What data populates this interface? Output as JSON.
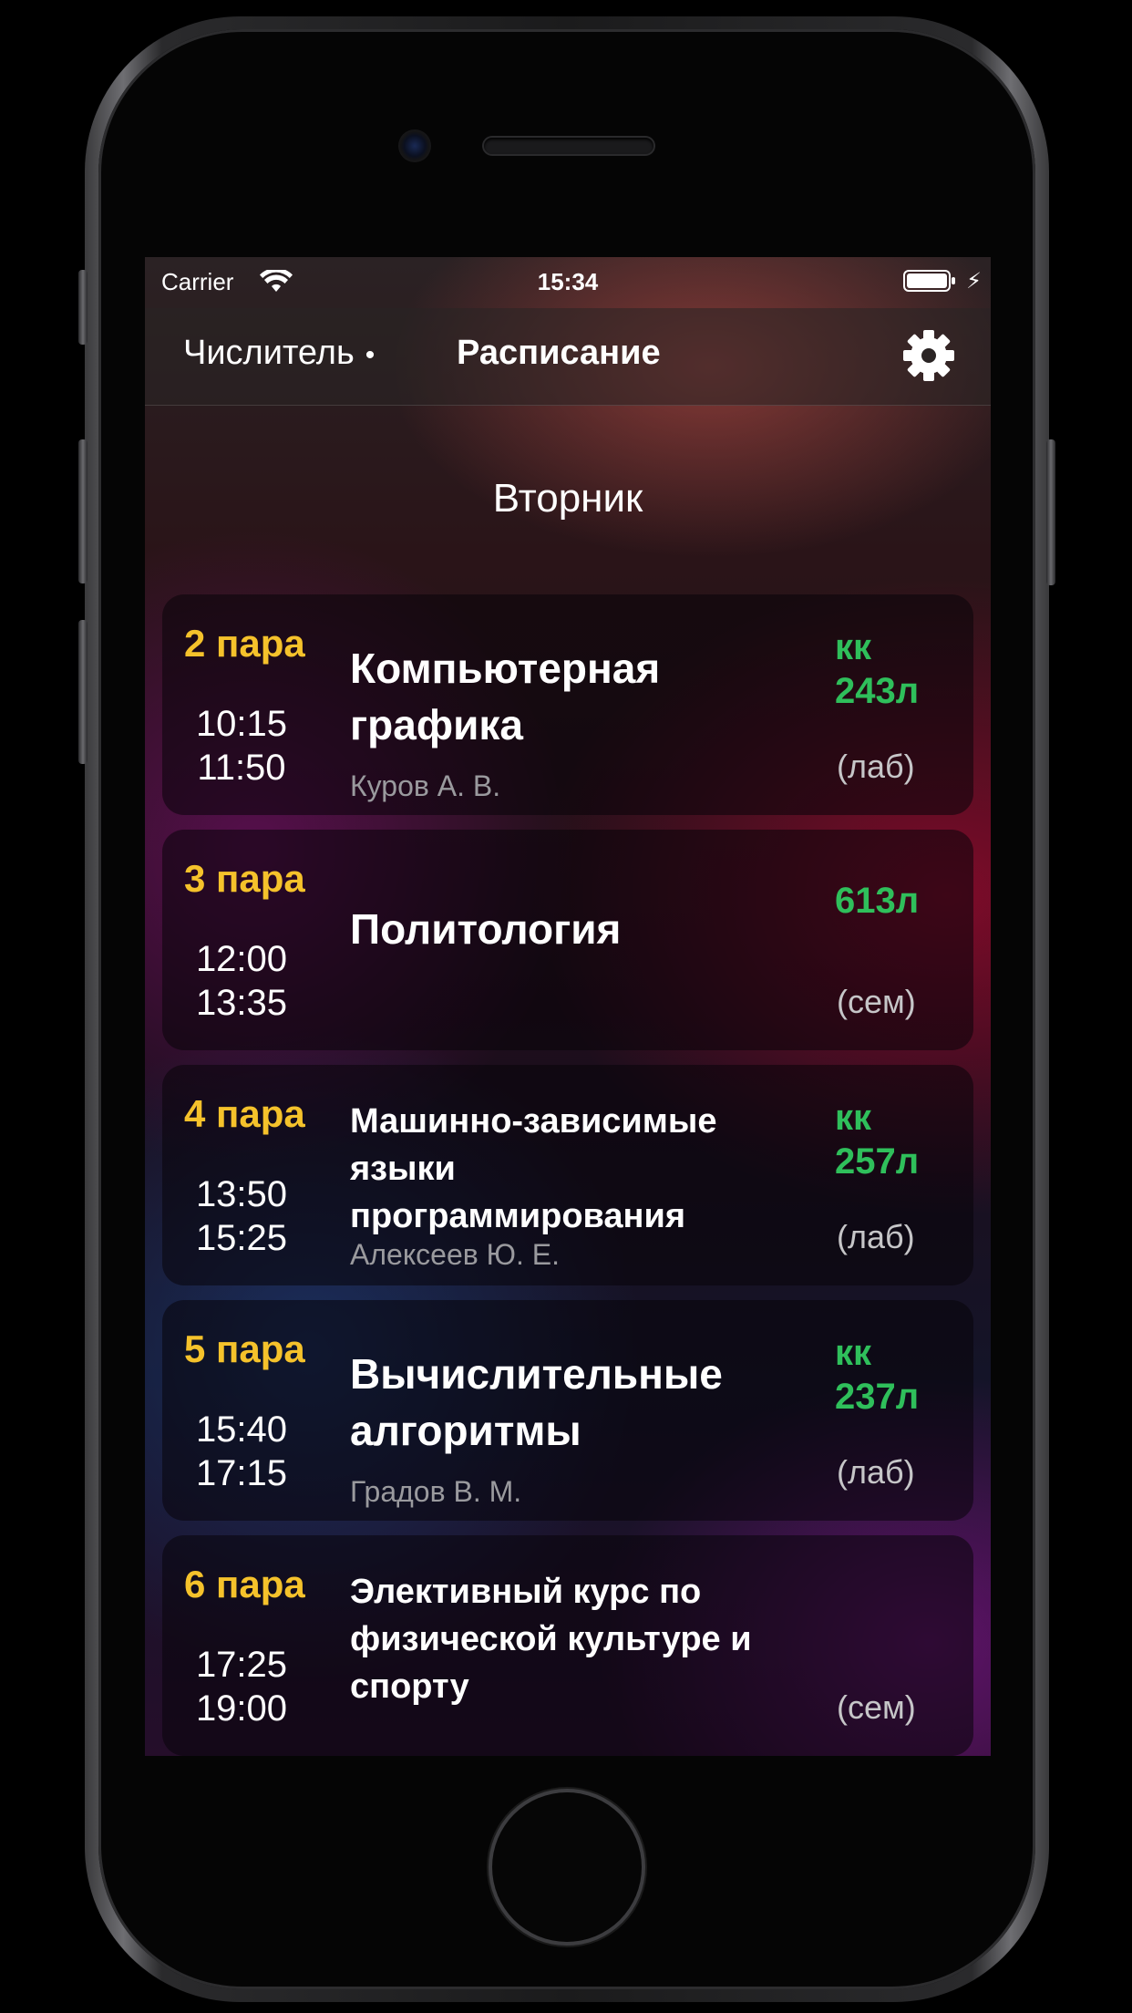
{
  "status_bar": {
    "carrier": "Carrier",
    "time": "15:34"
  },
  "nav": {
    "left_label": "Числитель",
    "left_dot": "•",
    "title": "Расписание",
    "settings_icon": "gear-icon"
  },
  "day": "Вторник",
  "colors": {
    "pair": "#f5c22b",
    "room": "#2fbf5b",
    "teacher": "#9a9a9e"
  },
  "lessons": [
    {
      "pair": "2 пара",
      "start": "10:15",
      "end": "11:50",
      "subject_lines": [
        "Компьютерная",
        "графика"
      ],
      "teacher": "Куров А. В.",
      "room_prefix": "кк",
      "room": "243л",
      "type": "(лаб)"
    },
    {
      "pair": "3 пара",
      "start": "12:00",
      "end": "13:35",
      "subject_lines": [
        "Политология"
      ],
      "teacher": "",
      "room_prefix": "",
      "room": "613л",
      "type": "(сем)"
    },
    {
      "pair": "4 пара",
      "start": "13:50",
      "end": "15:25",
      "subject_lines": [
        "Машинно-зависимые",
        "языки",
        "программирования"
      ],
      "teacher": "Алексеев Ю. Е.",
      "room_prefix": "кк",
      "room": "257л",
      "type": "(лаб)"
    },
    {
      "pair": "5 пара",
      "start": "15:40",
      "end": "17:15",
      "subject_lines": [
        "Вычислительные",
        "алгоритмы"
      ],
      "teacher": "Градов В. М.",
      "room_prefix": "кк",
      "room": "237л",
      "type": "(лаб)"
    },
    {
      "pair": "6 пара",
      "start": "17:25",
      "end": "19:00",
      "subject_lines": [
        "Элективный курс по",
        "физической культуре и",
        "спорту"
      ],
      "teacher": "",
      "room_prefix": "",
      "room": "",
      "type": "(сем)"
    }
  ]
}
